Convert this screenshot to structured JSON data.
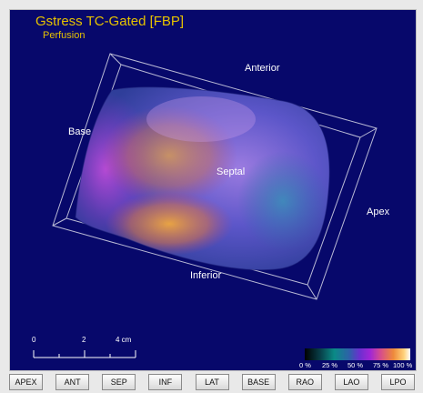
{
  "viewer": {
    "title": "Gstress TC-Gated [FBP]",
    "subtitle": "Perfusion"
  },
  "orientation_labels": {
    "anterior": "Anterior",
    "base": "Base",
    "septal": "Septal",
    "apex": "Apex",
    "inferior": "Inferior"
  },
  "scale_bar": {
    "labels": [
      "0",
      "2",
      "4 cm"
    ]
  },
  "colorbar": {
    "ticks": [
      "0 %",
      "25 %",
      "50 %",
      "75 %",
      "100 %"
    ]
  },
  "view_buttons": [
    "APEX",
    "ANT",
    "SEP",
    "INF",
    "LAT",
    "BASE",
    "RAO",
    "LAO",
    "LPO"
  ],
  "colors": {
    "background": "#07086b",
    "title": "#e6c200",
    "label": "#ffffff"
  }
}
